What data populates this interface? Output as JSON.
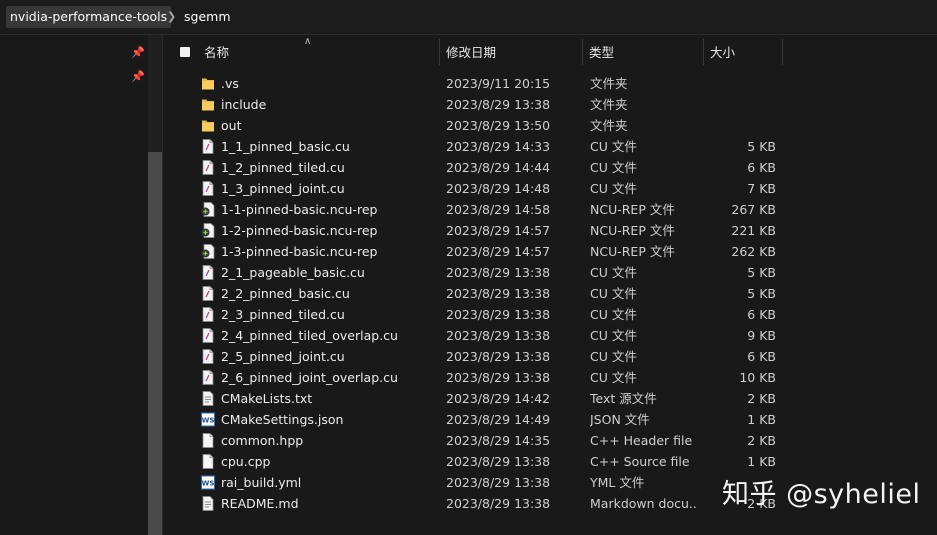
{
  "breadcrumb": {
    "parent": "nvidia-performance-tools",
    "current": "sgemm"
  },
  "columns": {
    "name": "名称",
    "date": "修改日期",
    "type": "类型",
    "size": "大小"
  },
  "files": [
    {
      "name": ".vs",
      "date": "2023/9/11 20:15",
      "type": "文件夹",
      "size": "",
      "icon": "folder-icon"
    },
    {
      "name": "include",
      "date": "2023/8/29 13:38",
      "type": "文件夹",
      "size": "",
      "icon": "folder-icon"
    },
    {
      "name": "out",
      "date": "2023/8/29 13:50",
      "type": "文件夹",
      "size": "",
      "icon": "folder-icon"
    },
    {
      "name": "1_1_pinned_basic.cu",
      "date": "2023/8/29 14:33",
      "type": "CU 文件",
      "size": "5 KB",
      "icon": "cu-file-icon"
    },
    {
      "name": "1_2_pinned_tiled.cu",
      "date": "2023/8/29 14:44",
      "type": "CU 文件",
      "size": "6 KB",
      "icon": "cu-file-icon"
    },
    {
      "name": "1_3_pinned_joint.cu",
      "date": "2023/8/29 14:48",
      "type": "CU 文件",
      "size": "7 KB",
      "icon": "cu-file-icon"
    },
    {
      "name": "1-1-pinned-basic.ncu-rep",
      "date": "2023/8/29 14:58",
      "type": "NCU-REP 文件",
      "size": "267 KB",
      "icon": "ncu-rep-file-icon"
    },
    {
      "name": "1-2-pinned-basic.ncu-rep",
      "date": "2023/8/29 14:57",
      "type": "NCU-REP 文件",
      "size": "221 KB",
      "icon": "ncu-rep-file-icon"
    },
    {
      "name": "1-3-pinned-basic.ncu-rep",
      "date": "2023/8/29 14:57",
      "type": "NCU-REP 文件",
      "size": "262 KB",
      "icon": "ncu-rep-file-icon"
    },
    {
      "name": "2_1_pageable_basic.cu",
      "date": "2023/8/29 13:38",
      "type": "CU 文件",
      "size": "5 KB",
      "icon": "cu-file-icon"
    },
    {
      "name": "2_2_pinned_basic.cu",
      "date": "2023/8/29 13:38",
      "type": "CU 文件",
      "size": "5 KB",
      "icon": "cu-file-icon"
    },
    {
      "name": "2_3_pinned_tiled.cu",
      "date": "2023/8/29 13:38",
      "type": "CU 文件",
      "size": "6 KB",
      "icon": "cu-file-icon"
    },
    {
      "name": "2_4_pinned_tiled_overlap.cu",
      "date": "2023/8/29 13:38",
      "type": "CU 文件",
      "size": "9 KB",
      "icon": "cu-file-icon"
    },
    {
      "name": "2_5_pinned_joint.cu",
      "date": "2023/8/29 13:38",
      "type": "CU 文件",
      "size": "6 KB",
      "icon": "cu-file-icon"
    },
    {
      "name": "2_6_pinned_joint_overlap.cu",
      "date": "2023/8/29 13:38",
      "type": "CU 文件",
      "size": "10 KB",
      "icon": "cu-file-icon"
    },
    {
      "name": "CMakeLists.txt",
      "date": "2023/8/29 14:42",
      "type": "Text 源文件",
      "size": "2 KB",
      "icon": "text-file-icon"
    },
    {
      "name": "CMakeSettings.json",
      "date": "2023/8/29 14:49",
      "type": "JSON 文件",
      "size": "1 KB",
      "icon": "vs-json-file-icon"
    },
    {
      "name": "common.hpp",
      "date": "2023/8/29 14:35",
      "type": "C++ Header file",
      "size": "2 KB",
      "icon": "blank-file-icon"
    },
    {
      "name": "cpu.cpp",
      "date": "2023/8/29 13:38",
      "type": "C++ Source file",
      "size": "1 KB",
      "icon": "blank-file-icon"
    },
    {
      "name": "rai_build.yml",
      "date": "2023/8/29 13:38",
      "type": "YML 文件",
      "size": "",
      "icon": "vs-yml-file-icon"
    },
    {
      "name": "README.md",
      "date": "2023/8/29 13:38",
      "type": "Markdown docu...",
      "size": "2 KB",
      "icon": "text-file-icon"
    }
  ],
  "watermark": "知乎 @syheliel"
}
